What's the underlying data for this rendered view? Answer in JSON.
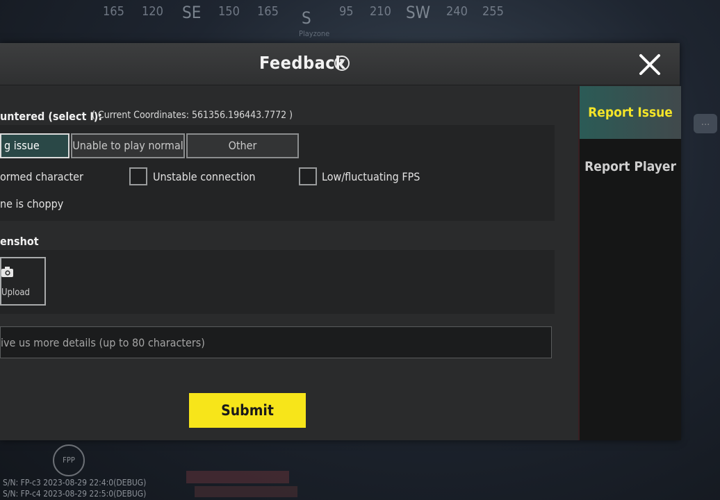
{
  "background": {
    "compass": {
      "marks": [
        "165",
        "120",
        "SE",
        "150",
        "165",
        "S",
        "95",
        "210",
        "SW",
        "240",
        "255"
      ],
      "playzone": "Playzone"
    },
    "hud": {
      "fpp_label": "FPP",
      "line1": "S/N: FP-c3   2023-08-29 22:4:0(DEBUG)",
      "line2": "S/N: FP-c4   2023-08-29 22:5:0(DEBUG)"
    }
  },
  "dialog": {
    "title": "Feedback",
    "help_icon": "?",
    "tabs": [
      {
        "label": "Report Issue",
        "active": true
      },
      {
        "label": "Report Player",
        "active": false
      }
    ],
    "issue_label": "untered (select I):",
    "coordinates": "( Current Coordinates:  561356.196443.7772 )",
    "categories": [
      {
        "label": "g issue",
        "selected": true
      },
      {
        "label": "Unable to play normal",
        "selected": false
      },
      {
        "label": "Other",
        "selected": false
      }
    ],
    "options": [
      {
        "label": "ormed character",
        "checked": false
      },
      {
        "label": "Unstable connection",
        "checked": false
      },
      {
        "label": "Low/fluctuating FPS",
        "checked": false
      },
      {
        "label": "ne is choppy",
        "checked": false
      }
    ],
    "screenshot_label": "enshot",
    "upload_label": "Upload",
    "details_placeholder": "ive us more details (up to 80 characters)",
    "submit_label": "Submit"
  },
  "colors": {
    "accent_yellow": "#f7e51a",
    "tab_active_text": "#f4e428",
    "selected_category_bg": "#2a4847"
  }
}
